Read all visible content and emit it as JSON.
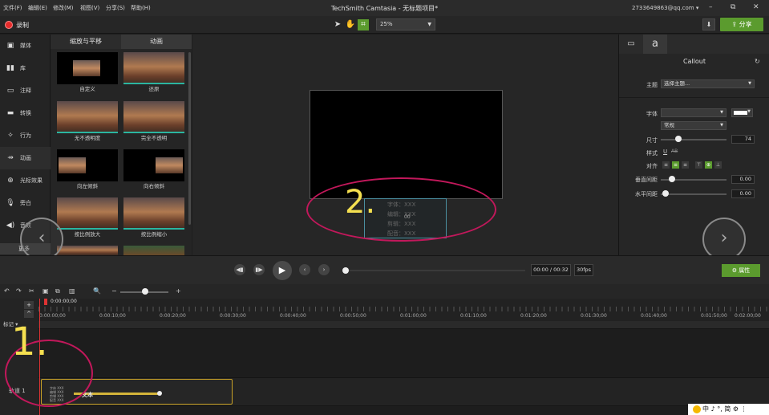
{
  "title_bar": {
    "menu": [
      "文件(F)",
      "编辑(E)",
      "修改(M)",
      "视图(V)",
      "分享(S)",
      "帮助(H)"
    ],
    "app_title": "TechSmith Camtasia - 无标题项目*",
    "account": "2733649863@qq.com ▾",
    "window_buttons": [
      "–",
      "⧉",
      "✕"
    ]
  },
  "toolbar": {
    "record_label": "录制",
    "zoom_value": "25%",
    "share_label": "⇪ 分享",
    "download_icon": "⬇"
  },
  "sidebar": {
    "items": [
      {
        "icon": "▣",
        "label": "媒体"
      },
      {
        "icon": "▮▮",
        "label": "库"
      },
      {
        "icon": "▭",
        "label": "注释"
      },
      {
        "icon": "▬",
        "label": "转换"
      },
      {
        "icon": "✧",
        "label": "行为"
      },
      {
        "icon": "⇸",
        "label": "动画"
      },
      {
        "icon": "⊕",
        "label": "光标效果"
      },
      {
        "icon": "🎙",
        "label": "旁白"
      },
      {
        "icon": "◀)",
        "label": "音效"
      }
    ],
    "more_label": "更多"
  },
  "panel": {
    "tabs": [
      "缩放与平移",
      "动画"
    ],
    "thumbnails": [
      {
        "caption": "自定义"
      },
      {
        "caption": "还原"
      },
      {
        "caption": "无不透明度"
      },
      {
        "caption": "完全不透明"
      },
      {
        "caption": "向左倾斜"
      },
      {
        "caption": "向右倾斜"
      },
      {
        "caption": "按比例放大"
      },
      {
        "caption": "按比例缩小"
      }
    ]
  },
  "canvas": {
    "callout_lines": [
      "字体：XXX",
      "编辑：XXX",
      "剪辑：XXX",
      "配音：XXX"
    ],
    "callout_center": "00",
    "annotation_number": "2."
  },
  "properties": {
    "title": "Callout",
    "theme_label": "主题",
    "theme_value": "选择主题...",
    "font_label": "字体",
    "font_value": "",
    "style_value": "常规",
    "size_label": "尺寸",
    "size_value": "74",
    "style_label": "样式",
    "style_buttons": [
      "U",
      "AB"
    ],
    "align_label": "对齐",
    "align_buttons": [
      "≡",
      "≡",
      "≡",
      "⊤",
      "⊕",
      "⊥"
    ],
    "line_spacing_label": "垂直间距",
    "line_spacing_value": "0.00",
    "char_spacing_label": "水平间距",
    "char_spacing_value": "0.00",
    "tab_icons": [
      "▭",
      "a"
    ],
    "reset_icon": "↻"
  },
  "playback": {
    "time": "00:00 / 00:32",
    "fps": "30fps",
    "properties_button": "⚙ 属性",
    "buttons": [
      "◀▮",
      "▮▶",
      "▶",
      "‹",
      "›"
    ]
  },
  "timeline": {
    "tools": [
      "↶",
      "↷",
      "✂",
      "▣",
      "⧉",
      "▥",
      "🔍",
      "−",
      "+"
    ],
    "playhead_time": "0:00:00;00",
    "ruler_labels": [
      "0:00:00;00",
      "0:00:10;00",
      "0:00:20;00",
      "0:00:30;00",
      "0:00:40;00",
      "0:00:50;00",
      "0:01:00;00",
      "0:01:10;00",
      "0:01:20;00",
      "0:01:30;00",
      "0:01:40;00",
      "0:01:50;00",
      "0:02:00;00"
    ],
    "marker_label": "标记 ▾",
    "track_label": "轨道 1",
    "header_buttons": [
      "+",
      "^"
    ],
    "clip_label": "文本",
    "clip_thumb_lines": [
      "字体 XXX",
      "编辑 XXX",
      "剪辑 XXX",
      "配音 XXX"
    ],
    "annotation_number": "1."
  },
  "ime": {
    "text": "中 ♪ °, 简 ⚙ ⋮"
  },
  "nav": {
    "left": "‹",
    "right": "›"
  },
  "colors": {
    "accent_green": "#5b9b2e",
    "record_red": "#e52b2b",
    "annotation_magenta": "#c2185b",
    "annotation_yellow": "#f5e050",
    "clip_border": "#c9a227",
    "playhead": "#dd3333"
  }
}
